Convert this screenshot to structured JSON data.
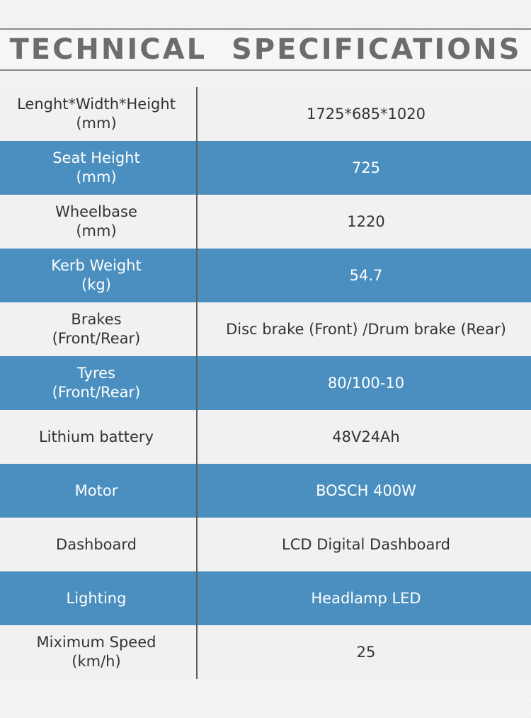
{
  "header": {
    "title": "TECHNICAL  SPECIFICATIONS"
  },
  "specs": [
    {
      "label": "Lenght*Width*Height\n(mm)",
      "value": "1725*685*1020"
    },
    {
      "label": "Seat Height\n(mm)",
      "value": "725"
    },
    {
      "label": "Wheelbase\n(mm)",
      "value": "1220"
    },
    {
      "label": "Kerb Weight\n(kg)",
      "value": "54.7"
    },
    {
      "label": "Brakes\n(Front/Rear)",
      "value": "Disc brake (Front) /Drum brake (Rear)"
    },
    {
      "label": "Tyres\n(Front/Rear)",
      "value": "80/100-10"
    },
    {
      "label": "Lithium battery",
      "value": "48V24Ah"
    },
    {
      "label": "Motor",
      "value": "BOSCH 400W"
    },
    {
      "label": "Dashboard",
      "value": "LCD Digital Dashboard"
    },
    {
      "label": "Lighting",
      "value": "Headlamp LED"
    },
    {
      "label": "Miximum Speed\n(km/h)",
      "value": "25"
    }
  ],
  "colors": {
    "row_light": "#f1f1f1",
    "row_blue": "#4a8fbf",
    "title_gray": "#6c6c6c",
    "divider": "#5e5e5e"
  }
}
